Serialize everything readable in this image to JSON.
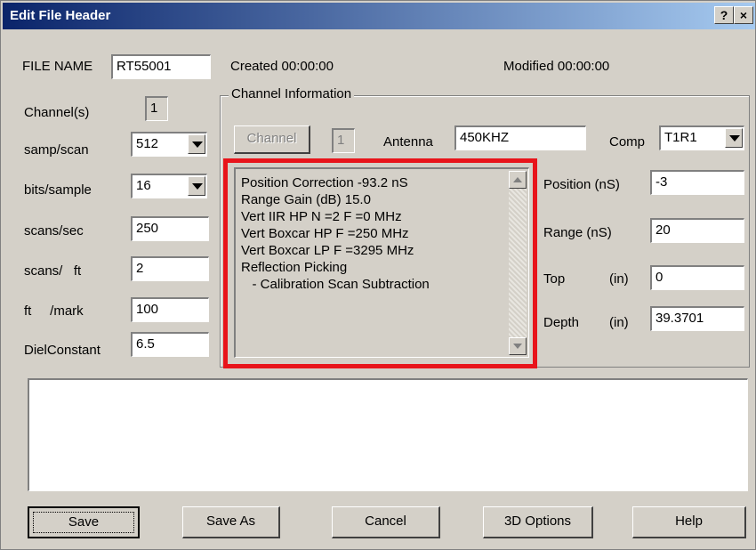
{
  "window": {
    "title": "Edit File Header",
    "help_btn": "?",
    "close_btn": "×"
  },
  "header": {
    "file_name_label": "FILE NAME",
    "file_name_value": "RT55001",
    "created": "Created 00:00:00",
    "modified": "Modified 00:00:00"
  },
  "left": {
    "channels_label": "Channel(s)",
    "channels_value": "1",
    "samp_scan_label": "samp/scan",
    "samp_scan_value": "512",
    "bits_sample_label": "bits/sample",
    "bits_sample_value": "16",
    "scans_sec_label": "scans/sec",
    "scans_sec_value": "250",
    "scans_ft_label": "scans/   ft",
    "scans_ft_value": "2",
    "ft_mark_label": "ft     /mark",
    "ft_mark_value": "100",
    "diel_label": "DielConstant",
    "diel_value": "6.5"
  },
  "channel_info": {
    "group_title": "Channel Information",
    "channel_button": "Channel",
    "channel_value": "1",
    "antenna_label": "Antenna",
    "antenna_value": "450KHZ",
    "comp_label": "Comp",
    "comp_value": "T1R1",
    "processing_lines": [
      "Position Correction  -93.2 nS",
      "Range Gain (dB)  15.0",
      "Vert IIR HP N =2 F =0 MHz",
      "Vert Boxcar HP  F =250 MHz",
      "Vert Boxcar LP  F =3295 MHz",
      "Reflection Picking",
      "   - Calibration Scan Subtraction"
    ],
    "position_label": "Position (nS)",
    "position_value": "-3",
    "range_label": "Range (nS)",
    "range_value": "20",
    "top_label": "Top",
    "top_unit": "(in)",
    "top_value": "0",
    "depth_label": "Depth",
    "depth_unit": "(in)",
    "depth_value": "39.3701"
  },
  "notes": {
    "text": ""
  },
  "buttons": {
    "save": "Save",
    "save_as": "Save As",
    "cancel": "Cancel",
    "options_3d": "3D Options",
    "help": "Help"
  },
  "colors": {
    "title_bar_start": "#0a246a",
    "title_bar_end": "#a6caf0",
    "dialog_bg": "#d4d0c8",
    "highlight": "#e8141b"
  }
}
